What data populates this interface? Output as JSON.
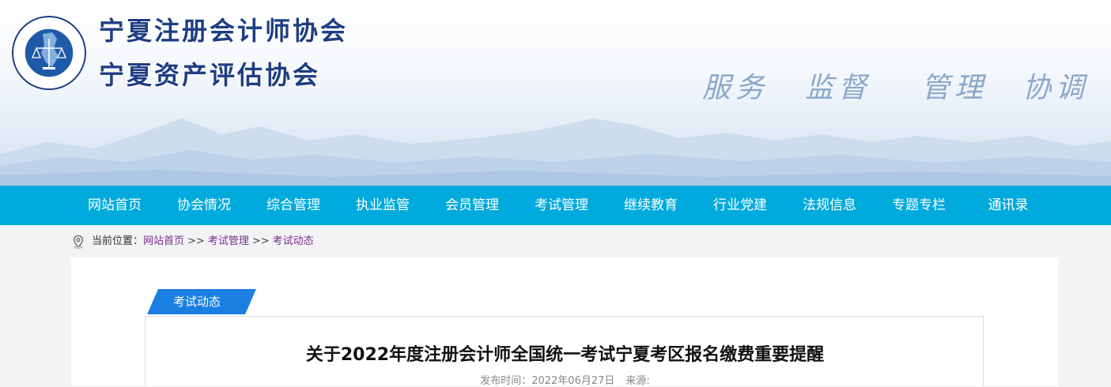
{
  "header": {
    "titles": [
      "宁夏注册会计师协会",
      "宁夏资产评估协会"
    ],
    "slogan": [
      "服务",
      "监督",
      "管理",
      "协调"
    ],
    "logo": {
      "icon": "association-seal-icon",
      "ring_text": "NING XIA INSTITUTE OF CERTIFIED PUBLIC ACCOUNTANTS",
      "inner_text": "宁夏注册会计师协会"
    }
  },
  "nav": {
    "items": [
      "网站首页",
      "协会情况",
      "综合管理",
      "执业监管",
      "会员管理",
      "考试管理",
      "继续教育",
      "行业党建",
      "法规信息",
      "专题专栏",
      "通讯录"
    ]
  },
  "breadcrumb": {
    "icon": "location-pin-icon",
    "prefix": "当前位置：",
    "separator": ">>",
    "items": [
      "网站首页",
      "考试管理",
      "考试动态"
    ]
  },
  "section": {
    "tag": "考试动态"
  },
  "article": {
    "title": "关于2022年度注册会计师全国统一考试宁夏考区报名缴费重要提醒",
    "publish_label": "发布时间：",
    "publish_date": "2022年06月27日",
    "source_label": "来源:"
  },
  "colors": {
    "nav_bg": "#00aadc",
    "title_blue": "#1f3e82",
    "tag_blue": "#1a7fe0",
    "link_purple": "#7a2e8c"
  }
}
